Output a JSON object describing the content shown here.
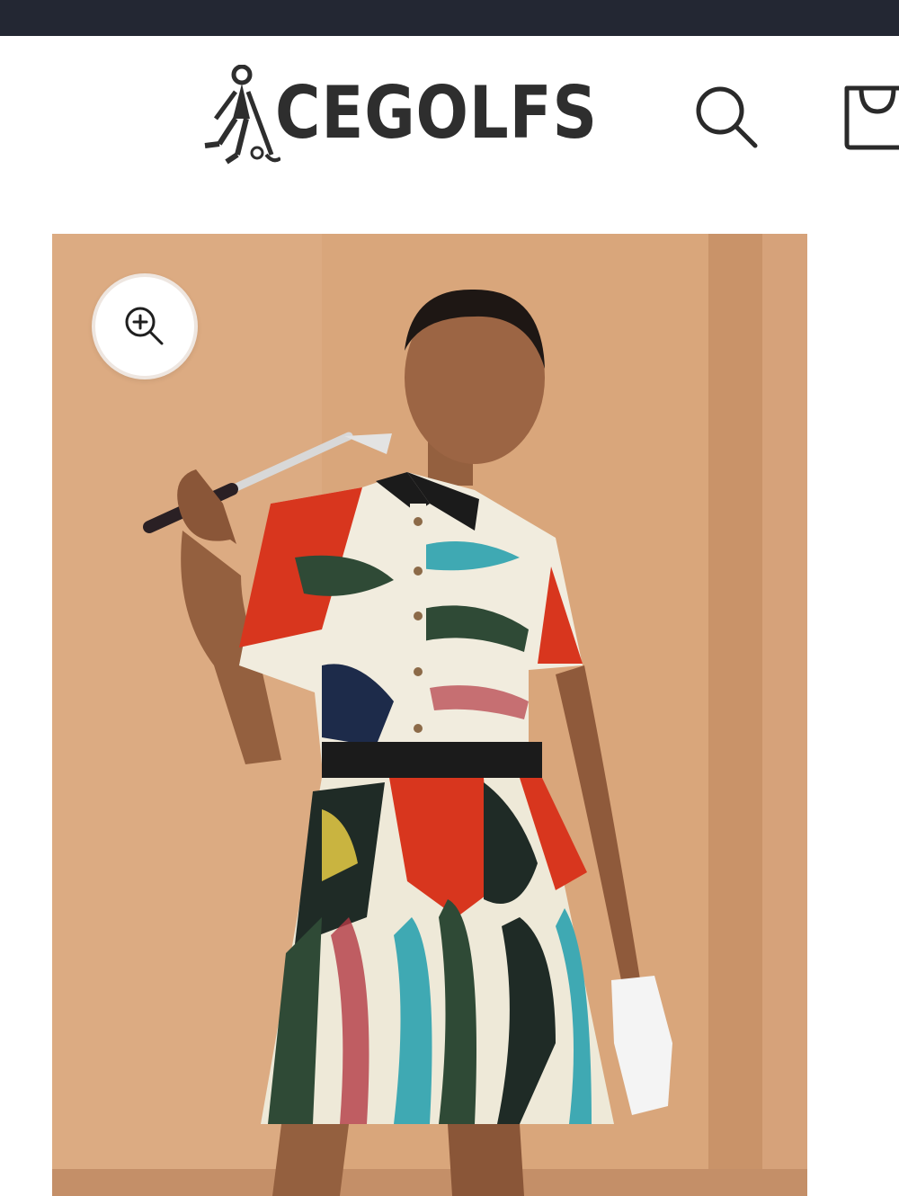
{
  "store": {
    "logo_text": "CEGOLFS"
  },
  "header": {
    "search_icon": "search-icon",
    "cart_icon": "cart-icon"
  },
  "product": {
    "zoom_icon": "zoom-in-icon",
    "colors": {
      "topbar": "#232733",
      "backdrop": "#d8a57a",
      "accent_red": "#d8361e",
      "accent_teal": "#3fa9b3",
      "accent_green": "#2f4a36"
    }
  }
}
